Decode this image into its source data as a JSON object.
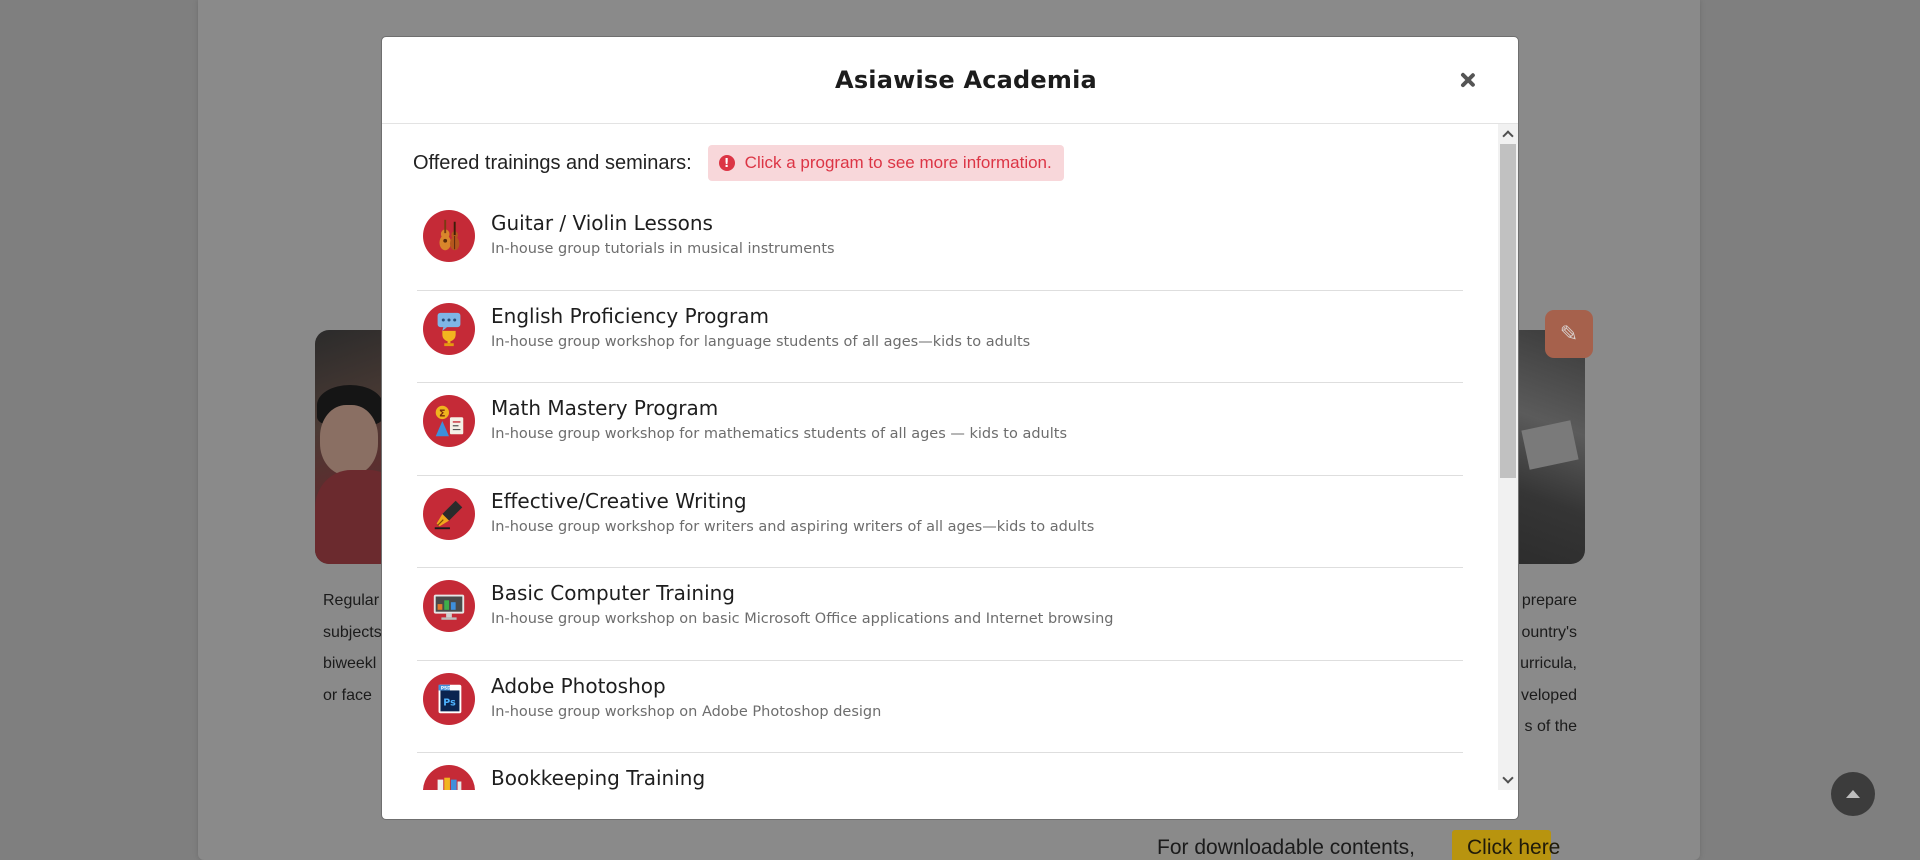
{
  "background": {
    "paragraph_left_fragments": [
      "Regular",
      "subjects",
      "biweekl",
      "or face"
    ],
    "paragraph_right_fragments": [
      "prepare",
      "ountry's",
      "urricula,",
      "veloped",
      "s of the"
    ],
    "download_text": "For downloadable contents,",
    "download_button": "Click here"
  },
  "modal": {
    "title": "Asiawise Academia",
    "intro_label": "Offered trainings and seminars:",
    "alert_text": "Click a program to see more information.",
    "programs": [
      {
        "title": "Guitar / Violin Lessons",
        "description": "In-house group tutorials in musical instruments",
        "icon": "guitar-violin-icon"
      },
      {
        "title": "English Proficiency Program",
        "description": "In-house group workshop for language students of all ages—kids to adults",
        "icon": "speech-trophy-icon"
      },
      {
        "title": "Math Mastery Program",
        "description": "In-house group workshop for mathematics students of all ages — kids to adults",
        "icon": "math-symbols-icon"
      },
      {
        "title": "Effective/Creative Writing",
        "description": "In-house group workshop for writers and aspiring writers of all ages—kids to adults",
        "icon": "fountain-pen-icon"
      },
      {
        "title": "Basic Computer Training",
        "description": "In-house group workshop on basic Microsoft Office applications and Internet browsing",
        "icon": "computer-monitor-icon"
      },
      {
        "title": "Adobe Photoshop",
        "description": "In-house group workshop on Adobe Photoshop design",
        "icon": "photoshop-file-icon"
      },
      {
        "title": "Bookkeeping Training",
        "description": "",
        "icon": "ledger-books-icon"
      }
    ]
  },
  "colors": {
    "accent_icon_bg": "#c52a37",
    "alert_bg": "#f8d7da",
    "alert_text": "#dc3545"
  }
}
